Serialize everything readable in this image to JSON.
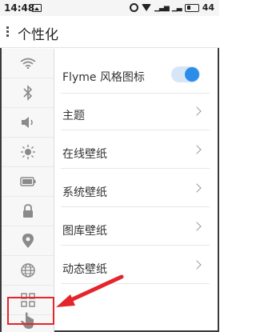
{
  "status_bar": {
    "time": "14:48",
    "battery": "44"
  },
  "header": {
    "title": "个性化"
  },
  "rail": {
    "items": [
      {
        "icon": "wifi-icon",
        "glyph": "≋"
      },
      {
        "icon": "bluetooth-icon",
        "glyph": "ᛒ"
      },
      {
        "icon": "sound-icon",
        "glyph": "🔈"
      },
      {
        "icon": "brightness-icon",
        "glyph": "☀"
      },
      {
        "icon": "battery-icon",
        "glyph": "▭"
      },
      {
        "icon": "lock-icon",
        "glyph": "🔒"
      },
      {
        "icon": "location-icon",
        "glyph": "⦿"
      },
      {
        "icon": "globe-icon",
        "glyph": "⊕"
      },
      {
        "icon": "apps-grid-icon",
        "glyph": "⊞"
      },
      {
        "icon": "hand-gesture-icon",
        "glyph": "☝"
      }
    ]
  },
  "settings": {
    "flyme_icon_style": {
      "label": "Flyme 风格图标",
      "enabled": true
    },
    "items": [
      {
        "label": "主题"
      },
      {
        "label": "在线壁纸"
      },
      {
        "label": "系统壁纸"
      },
      {
        "label": "图库壁纸"
      },
      {
        "label": "动态壁纸"
      }
    ]
  },
  "colors": {
    "accent": "#2a8ee8",
    "annotation": "#e4252b"
  }
}
